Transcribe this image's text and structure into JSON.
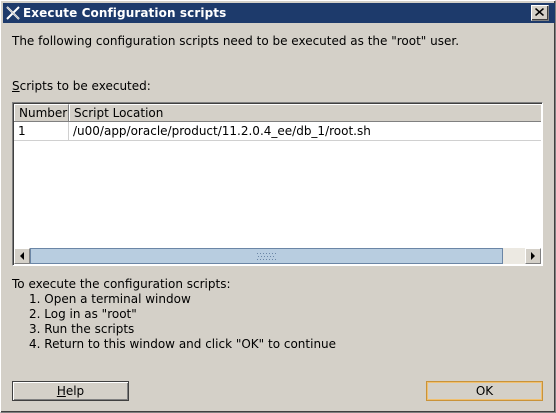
{
  "window": {
    "title": "Execute Configuration scripts"
  },
  "intro_text": "The following configuration scripts need to be executed as the \"root\" user.",
  "scripts_label_mnemonic": "S",
  "scripts_label_rest": "cripts to be executed:",
  "table": {
    "columns": [
      "Number",
      "Script Location"
    ],
    "rows": [
      {
        "number": "1",
        "location": "/u00/app/oracle/product/11.2.0.4_ee/db_1/root.sh"
      }
    ]
  },
  "instructions": {
    "heading": "To execute the configuration scripts:",
    "steps": [
      "1.  Open a terminal window",
      "2.  Log in as \"root\"",
      "3.  Run the scripts",
      "4.  Return to this window and click \"OK\" to continue"
    ]
  },
  "buttons": {
    "help_mnemonic": "H",
    "help_rest": "elp",
    "ok": "OK"
  },
  "icons": {
    "app": "x-window-icon",
    "close": "close-icon",
    "scroll_left": "arrow-left-icon",
    "scroll_right": "arrow-right-icon"
  },
  "colors": {
    "titlebar": "#1d3a6b",
    "scroll_thumb": "#b8cde0",
    "ok_border": "#c9933a"
  }
}
